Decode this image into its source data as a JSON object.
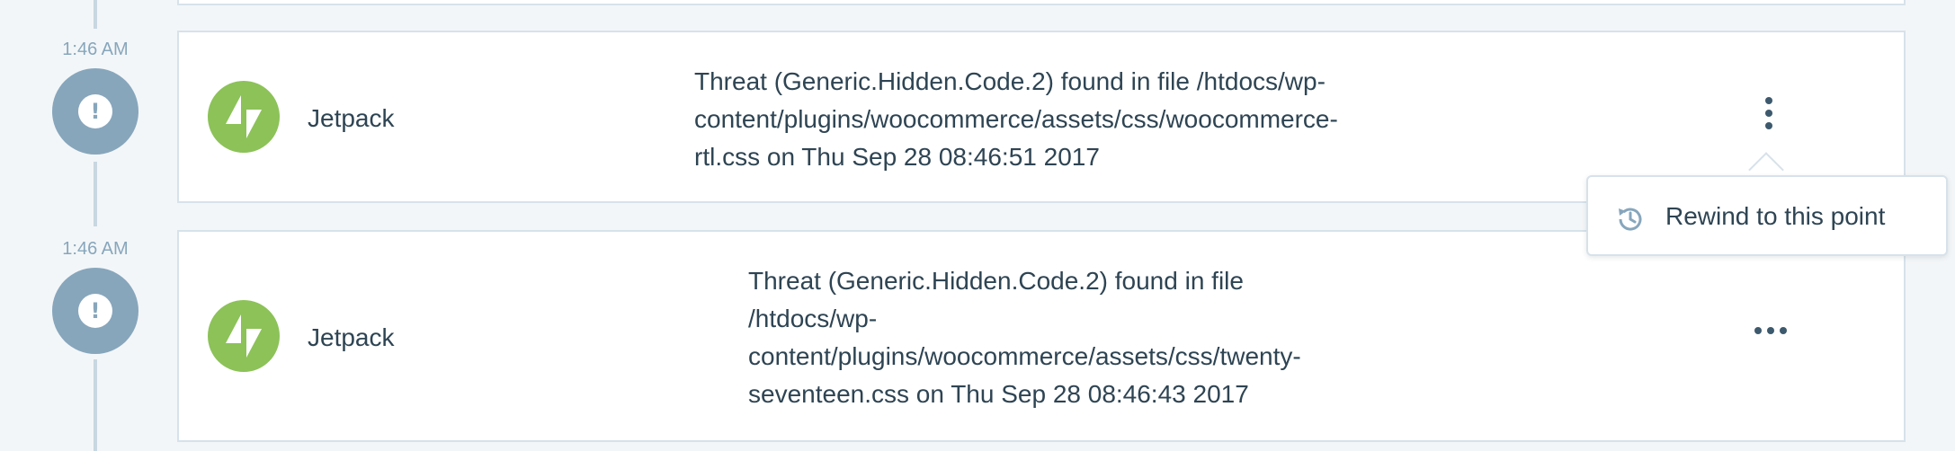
{
  "colors": {
    "background": "#f3f6f8",
    "timeline": "#c8d7e1",
    "status_circle": "#87a6bc",
    "jetpack_green": "#8cc258",
    "text": "#2e4453"
  },
  "events": [
    {
      "time": "1:46 AM",
      "status_icon": "exclamation-icon",
      "status_glyph": "!",
      "actor": "Jetpack",
      "actor_icon": "jetpack-logo-icon",
      "description_lines": [
        "Threat (Generic.Hidden.Code.2) found in file /htdocs/wp-",
        "content/plugins/woocommerce/assets/css/woocommerce-",
        "rtl.css on Thu Sep 28 08:46:51 2017"
      ],
      "action_icon": "vertical-ellipsis-icon"
    },
    {
      "time": "1:46 AM",
      "status_icon": "exclamation-icon",
      "status_glyph": "!",
      "actor": "Jetpack",
      "actor_icon": "jetpack-logo-icon",
      "description_lines": [
        "Threat (Generic.Hidden.Code.2) found in file",
        "/htdocs/wp-",
        "content/plugins/woocommerce/assets/css/twenty-",
        "seventeen.css on Thu Sep 28 08:46:43 2017"
      ],
      "action_icon": "horizontal-ellipsis-icon"
    }
  ],
  "popover_menu": {
    "items": [
      {
        "label": "Rewind to this point",
        "icon": "history-icon"
      }
    ]
  }
}
